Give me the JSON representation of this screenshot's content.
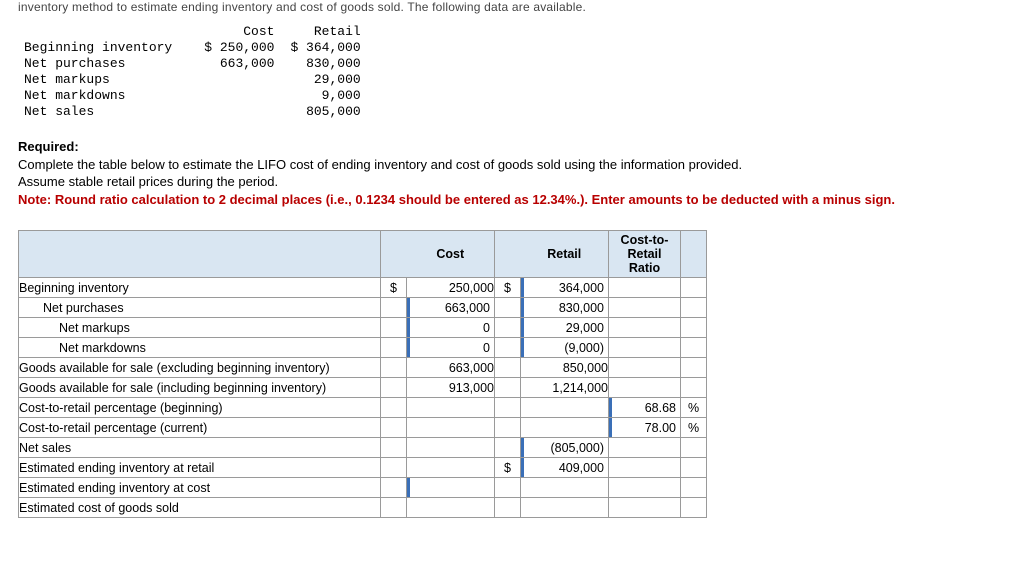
{
  "cutoff": "inventory method to estimate ending inventory and cost of goods sold. The following data are available.",
  "small": {
    "head": {
      "cost": "Cost",
      "retail": "Retail"
    },
    "rows": [
      {
        "label": "Beginning inventory",
        "cost": "$ 250,000",
        "retail": "$ 364,000"
      },
      {
        "label": "Net purchases",
        "cost": "663,000",
        "retail": "830,000"
      },
      {
        "label": "Net markups",
        "cost": "",
        "retail": "29,000"
      },
      {
        "label": "Net markdowns",
        "cost": "",
        "retail": "9,000"
      },
      {
        "label": "Net sales",
        "cost": "",
        "retail": "805,000"
      }
    ]
  },
  "req": {
    "title": "Required:",
    "line1": "Complete the table below to estimate the LIFO cost of ending inventory and cost of goods sold using the information provided.",
    "line2": "Assume stable retail prices during the period.",
    "note": "Note: Round ratio calculation to 2 decimal places (i.e., 0.1234 should be entered as 12.34%.). Enter amounts to be deducted with a minus sign."
  },
  "sheet": {
    "head": {
      "cost": "Cost",
      "retail": "Retail",
      "ratio1": "Cost-to-Retail",
      "ratio2": "Ratio"
    },
    "rows": [
      {
        "desc": "Beginning inventory",
        "ind": 0,
        "costInput": false,
        "cur1": "$",
        "cost": "250,000",
        "cur2": "$",
        "retail": "364,000",
        "ratio": "",
        "pct": ""
      },
      {
        "desc": "Net purchases",
        "ind": 1,
        "costInput": true,
        "cur1": "",
        "cost": "663,000",
        "cur2": "",
        "retail": "830,000",
        "ratio": "",
        "pct": ""
      },
      {
        "desc": "Net markups",
        "ind": 2,
        "costInput": true,
        "cur1": "",
        "cost": "0",
        "cur2": "",
        "retail": "29,000",
        "ratio": "",
        "pct": ""
      },
      {
        "desc": "Net markdowns",
        "ind": 2,
        "costInput": true,
        "cur1": "",
        "cost": "0",
        "cur2": "",
        "retail": "(9,000)",
        "ratio": "",
        "pct": ""
      },
      {
        "desc": "Goods available for sale (excluding beginning inventory)",
        "ind": 0,
        "costInput": false,
        "cur1": "",
        "cost": "663,000",
        "cur2": "",
        "retail": "850,000",
        "ratio": "",
        "pct": ""
      },
      {
        "desc": "Goods available for sale (including beginning inventory)",
        "ind": 0,
        "costInput": false,
        "cur1": "",
        "cost": "913,000",
        "cur2": "",
        "retail": "1,214,000",
        "ratio": "",
        "pct": ""
      },
      {
        "desc": "Cost-to-retail percentage (beginning)",
        "ind": 0,
        "costInput": false,
        "cur1": "",
        "cost": "",
        "cur2": "",
        "retail": "",
        "ratio": "68.68",
        "pct": "%"
      },
      {
        "desc": "Cost-to-retail percentage (current)",
        "ind": 0,
        "costInput": false,
        "cur1": "",
        "cost": "",
        "cur2": "",
        "retail": "",
        "ratio": "78.00",
        "pct": "%"
      },
      {
        "desc": "Net sales",
        "ind": 0,
        "costInput": false,
        "cur1": "",
        "cost": "",
        "cur2": "",
        "retail": "(805,000)",
        "ratio": "",
        "pct": ""
      },
      {
        "desc": "Estimated ending inventory at retail",
        "ind": 0,
        "costInput": false,
        "cur1": "",
        "cost": "",
        "cur2": "$",
        "retail": "409,000",
        "ratio": "",
        "pct": ""
      },
      {
        "desc": "Estimated ending inventory at cost",
        "ind": 0,
        "costInput": true,
        "cur1": "",
        "cost": "",
        "cur2": "",
        "retail": "",
        "ratio": "",
        "pct": ""
      },
      {
        "desc": "Estimated cost of goods sold",
        "ind": 0,
        "costInput": false,
        "cur1": "",
        "cost": "",
        "cur2": "",
        "retail": "",
        "ratio": "",
        "pct": ""
      }
    ]
  }
}
